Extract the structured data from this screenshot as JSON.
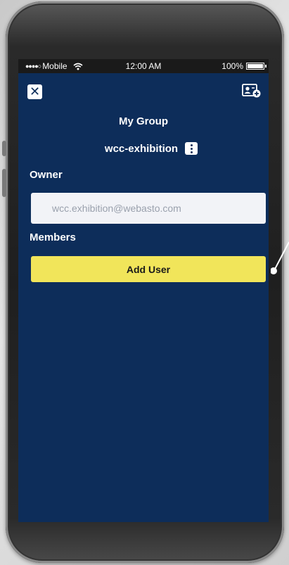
{
  "status_bar": {
    "signal_dots": "●●●●○",
    "carrier": "Mobile",
    "wifi_icon": "wifi-icon",
    "time": "12:00 AM",
    "battery_percent": "100%",
    "battery_level": 1.0
  },
  "header": {
    "close_icon": "close-icon",
    "close_glyph": "✕",
    "add_member_icon": "add-contact-icon",
    "title": "My Group"
  },
  "group": {
    "name": "wcc-exhibition",
    "menu_icon": "kebab-menu-icon"
  },
  "owner": {
    "label": "Owner",
    "email": "wcc.exhibition@webasto.com"
  },
  "members": {
    "label": "Members",
    "add_user_label": "Add User"
  },
  "colors": {
    "screen_background": "#0d2d5a",
    "accent_button": "#f1e55a",
    "field_background": "#f2f3f7"
  }
}
